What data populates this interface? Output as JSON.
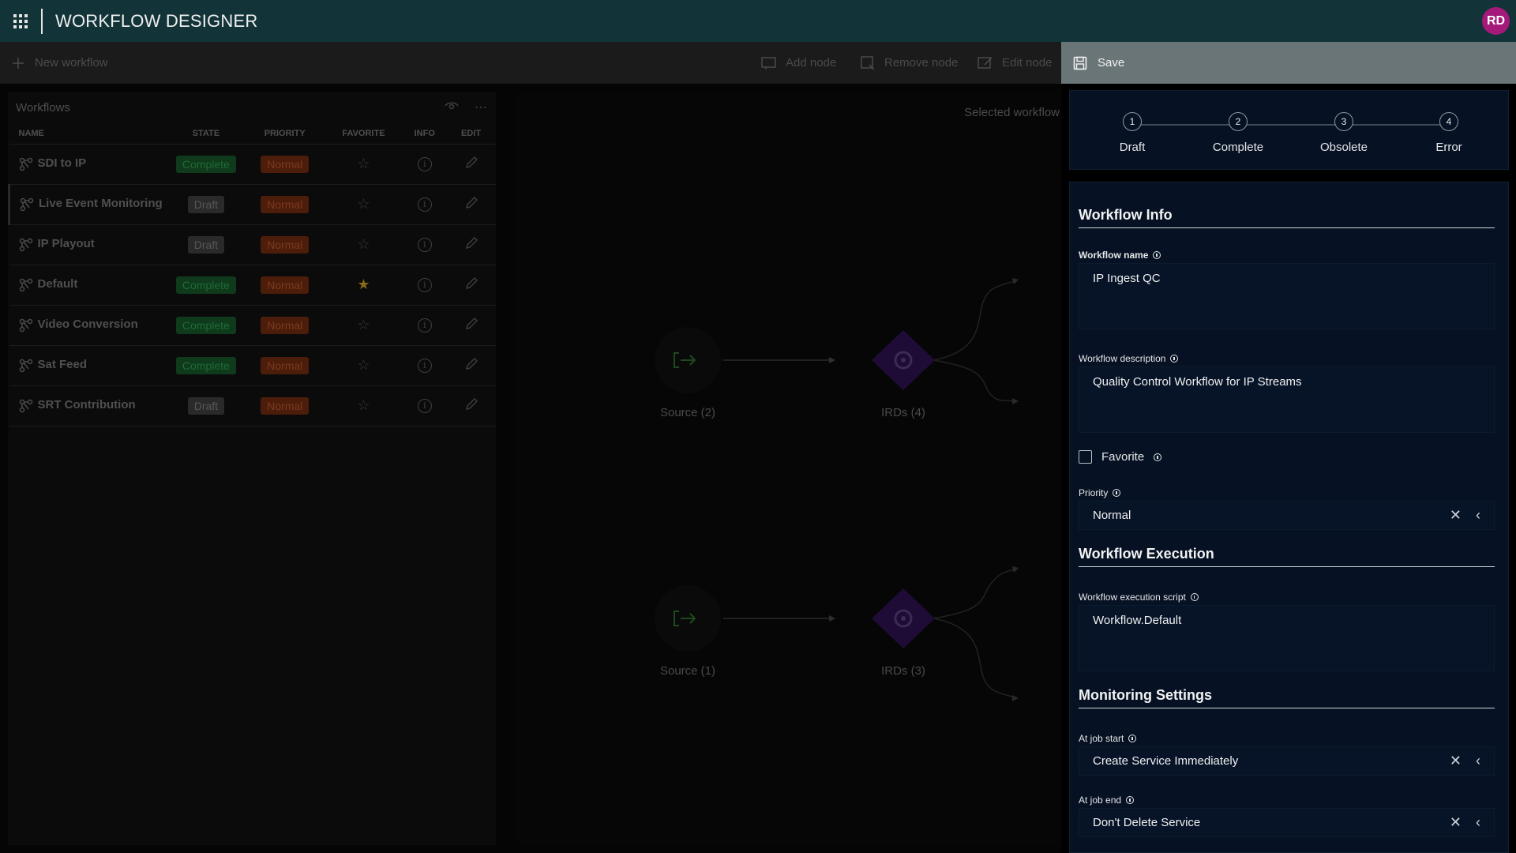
{
  "header": {
    "title": "WORKFLOW DESIGNER",
    "user_initials": "RD"
  },
  "toolbar": {
    "new_workflow": "New workflow",
    "add_node": "Add node",
    "remove_node": "Remove node",
    "edit_node": "Edit node",
    "save": "Save"
  },
  "workflows": {
    "title": "Workflows",
    "columns": [
      "NAME",
      "STATE",
      "PRIORITY",
      "FAVORITE",
      "INFO",
      "EDIT"
    ],
    "rows": [
      {
        "name": "SDI to IP",
        "state": "Complete",
        "priority": "Normal",
        "favorite": false
      },
      {
        "name": "Live Event Monitoring",
        "state": "Draft",
        "priority": "Normal",
        "favorite": false
      },
      {
        "name": "IP Playout",
        "state": "Draft",
        "priority": "Normal",
        "favorite": false
      },
      {
        "name": "Default",
        "state": "Complete",
        "priority": "Normal",
        "favorite": true
      },
      {
        "name": "Video Conversion",
        "state": "Complete",
        "priority": "Normal",
        "favorite": false
      },
      {
        "name": "Sat Feed",
        "state": "Complete",
        "priority": "Normal",
        "favorite": false
      },
      {
        "name": "SRT Contribution",
        "state": "Draft",
        "priority": "Normal",
        "favorite": false
      }
    ]
  },
  "canvas": {
    "label": "Selected workflow",
    "nodes": [
      {
        "label": "Source (2)"
      },
      {
        "label": "IRDs (4)"
      },
      {
        "label": "Source (1)"
      },
      {
        "label": "IRDs (3)"
      }
    ]
  },
  "stepper": {
    "steps": [
      {
        "num": "1",
        "label": "Draft"
      },
      {
        "num": "2",
        "label": "Complete"
      },
      {
        "num": "3",
        "label": "Obsolete"
      },
      {
        "num": "4",
        "label": "Error"
      }
    ]
  },
  "form": {
    "info_title": "Workflow Info",
    "name_label": "Workflow name",
    "name_value": "IP Ingest QC",
    "description_label": "Workflow description",
    "description_value": "Quality Control Workflow for IP Streams",
    "favorite_label": "Favorite",
    "priority_label": "Priority",
    "priority_value": "Normal",
    "execution_title": "Workflow Execution",
    "script_label": "Workflow execution script",
    "script_value": "Workflow.Default",
    "monitoring_title": "Monitoring Settings",
    "job_start_label": "At job start",
    "job_start_value": "Create Service Immediately",
    "job_end_label": "At job end",
    "job_end_value": "Don't Delete Service"
  }
}
